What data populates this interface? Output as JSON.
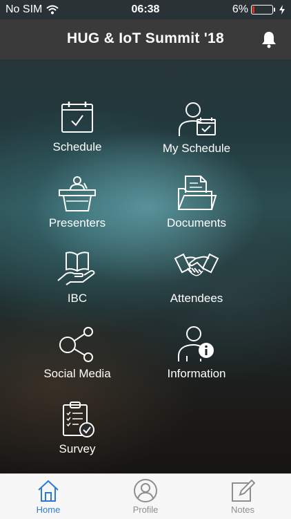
{
  "status_bar": {
    "carrier": "No SIM",
    "time": "06:38",
    "battery": "6%"
  },
  "header": {
    "title": "HUG & IoT Summit '18",
    "bell_icon": "bell-icon"
  },
  "menu": [
    {
      "label": "Schedule",
      "icon": "calendar-check-icon"
    },
    {
      "label": "My Schedule",
      "icon": "person-calendar-icon"
    },
    {
      "label": "Presenters",
      "icon": "podium-icon"
    },
    {
      "label": "Documents",
      "icon": "folder-icon"
    },
    {
      "label": "IBC",
      "icon": "book-hand-icon"
    },
    {
      "label": "Attendees",
      "icon": "handshake-icon"
    },
    {
      "label": "Social Media",
      "icon": "share-icon"
    },
    {
      "label": "Information",
      "icon": "person-info-icon"
    },
    {
      "label": "Survey",
      "icon": "clipboard-check-icon"
    }
  ],
  "tabs": [
    {
      "label": "Home",
      "icon": "home-icon",
      "active": true
    },
    {
      "label": "Profile",
      "icon": "profile-icon",
      "active": false
    },
    {
      "label": "Notes",
      "icon": "notes-icon",
      "active": false
    }
  ],
  "colors": {
    "header_bg": "#3a3a3a",
    "tab_active": "#2a7ad5",
    "tab_inactive": "#8e8e8e",
    "battery_low": "#e0301e"
  }
}
